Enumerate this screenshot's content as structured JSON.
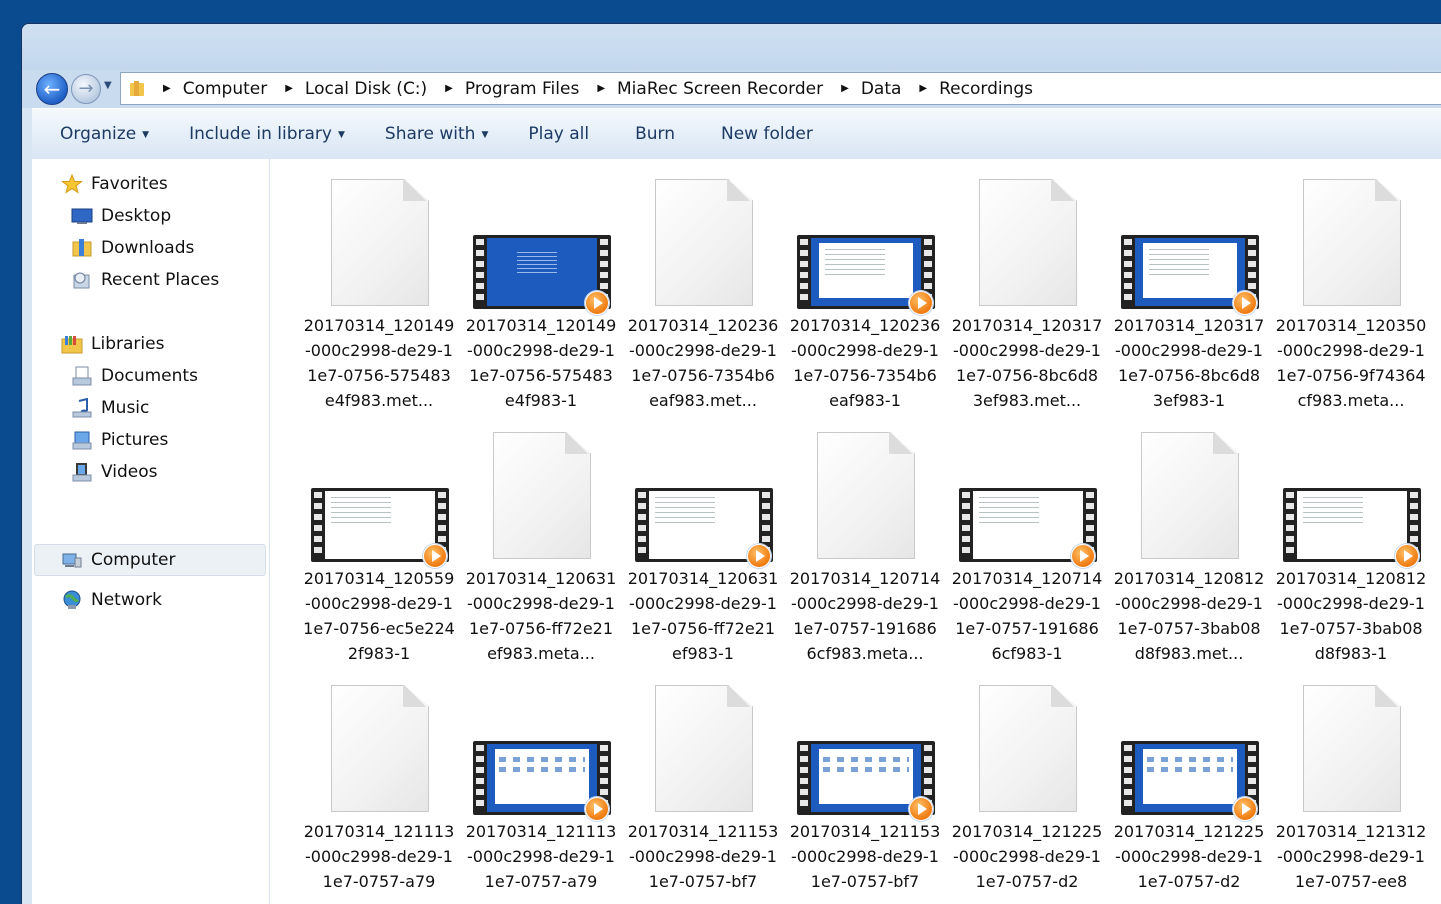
{
  "address": {
    "crumbs": [
      "Computer",
      "Local Disk (C:)",
      "Program Files",
      "MiaRec Screen Recorder",
      "Data",
      "Recordings"
    ]
  },
  "toolbar": {
    "organize": "Organize",
    "include_in_library": "Include in library",
    "share_with": "Share with",
    "play_all": "Play all",
    "burn": "Burn",
    "new_folder": "New folder"
  },
  "sidebar": {
    "favorites": "Favorites",
    "desktop": "Desktop",
    "downloads": "Downloads",
    "recent_places": "Recent Places",
    "libraries": "Libraries",
    "documents": "Documents",
    "music": "Music",
    "pictures": "Pictures",
    "videos": "Videos",
    "computer": "Computer",
    "network": "Network"
  },
  "files": [
    {
      "label": "20170314_120149-000c2998-de29-11e7-0756-575483e4f983.met...",
      "type": "doc"
    },
    {
      "label": "20170314_120149-000c2998-de29-11e7-0756-575483e4f983-1",
      "type": "video",
      "style": "desktop"
    },
    {
      "label": "20170314_120236-000c2998-de29-11e7-0756-7354b6eaf983.met...",
      "type": "doc"
    },
    {
      "label": "20170314_120236-000c2998-de29-11e7-0756-7354b6eaf983-1",
      "type": "video",
      "style": "window"
    },
    {
      "label": "20170314_120317-000c2998-de29-11e7-0756-8bc6d83ef983.met...",
      "type": "doc"
    },
    {
      "label": "20170314_120317-000c2998-de29-11e7-0756-8bc6d83ef983-1",
      "type": "video",
      "style": "window"
    },
    {
      "label": "20170314_120350-000c2998-de29-11e7-0756-9f74364cf983.meta...",
      "type": "doc"
    },
    {
      "label": "20170314_120559-000c2998-de29-11e7-0756-ec5e2242f983-1",
      "type": "video",
      "style": "full"
    },
    {
      "label": "20170314_120631-000c2998-de29-11e7-0756-ff72e21ef983.meta...",
      "type": "doc"
    },
    {
      "label": "20170314_120631-000c2998-de29-11e7-0756-ff72e21ef983-1",
      "type": "video",
      "style": "full"
    },
    {
      "label": "20170314_120714-000c2998-de29-11e7-0757-1916866cf983.meta...",
      "type": "doc"
    },
    {
      "label": "20170314_120714-000c2998-de29-11e7-0757-1916866cf983-1",
      "type": "video",
      "style": "full"
    },
    {
      "label": "20170314_120812-000c2998-de29-11e7-0757-3bab08d8f983.met...",
      "type": "doc"
    },
    {
      "label": "20170314_120812-000c2998-de29-11e7-0757-3bab08d8f983-1",
      "type": "video",
      "style": "full"
    },
    {
      "label": "20170314_121113-000c2998-de29-11e7-0757-a79",
      "type": "doc"
    },
    {
      "label": "20170314_121113-000c2998-de29-11e7-0757-a79",
      "type": "video",
      "style": "explorer"
    },
    {
      "label": "20170314_121153-000c2998-de29-11e7-0757-bf7",
      "type": "doc"
    },
    {
      "label": "20170314_121153-000c2998-de29-11e7-0757-bf7",
      "type": "video",
      "style": "explorer"
    },
    {
      "label": "20170314_121225-000c2998-de29-11e7-0757-d2",
      "type": "doc"
    },
    {
      "label": "20170314_121225-000c2998-de29-11e7-0757-d2",
      "type": "video",
      "style": "explorer"
    },
    {
      "label": "20170314_121312-000c2998-de29-11e7-0757-ee8",
      "type": "doc"
    }
  ]
}
